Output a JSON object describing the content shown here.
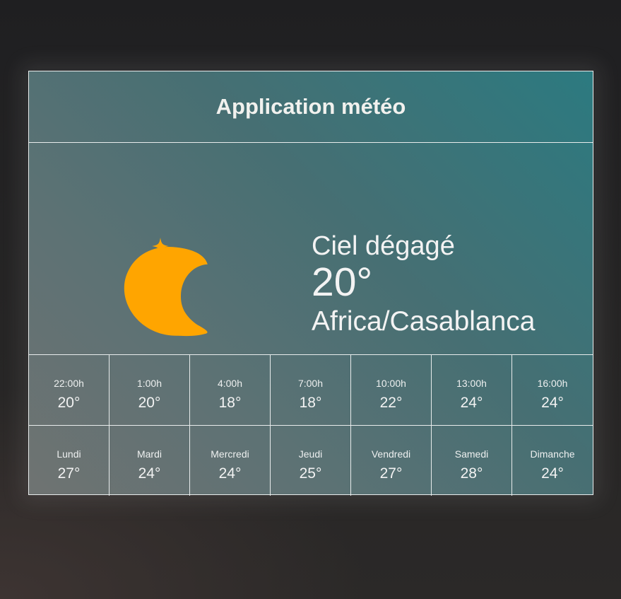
{
  "app": {
    "title": "Application météo"
  },
  "current": {
    "icon": "crescent-moon-stars-icon",
    "icon_color": "#ffa500",
    "condition": "Ciel dégagé",
    "temperature": "20°",
    "location": "Africa/Casablanca"
  },
  "hourly": [
    {
      "time": "22:00h",
      "temp": "20°"
    },
    {
      "time": "1:00h",
      "temp": "20°"
    },
    {
      "time": "4:00h",
      "temp": "18°"
    },
    {
      "time": "7:00h",
      "temp": "18°"
    },
    {
      "time": "10:00h",
      "temp": "22°"
    },
    {
      "time": "13:00h",
      "temp": "24°"
    },
    {
      "time": "16:00h",
      "temp": "24°"
    }
  ],
  "daily": [
    {
      "day": "Lundi",
      "temp": "27°"
    },
    {
      "day": "Mardi",
      "temp": "24°"
    },
    {
      "day": "Mercredi",
      "temp": "24°"
    },
    {
      "day": "Jeudi",
      "temp": "25°"
    },
    {
      "day": "Vendredi",
      "temp": "27°"
    },
    {
      "day": "Samedi",
      "temp": "28°"
    },
    {
      "day": "Dimanche",
      "temp": "24°"
    }
  ]
}
